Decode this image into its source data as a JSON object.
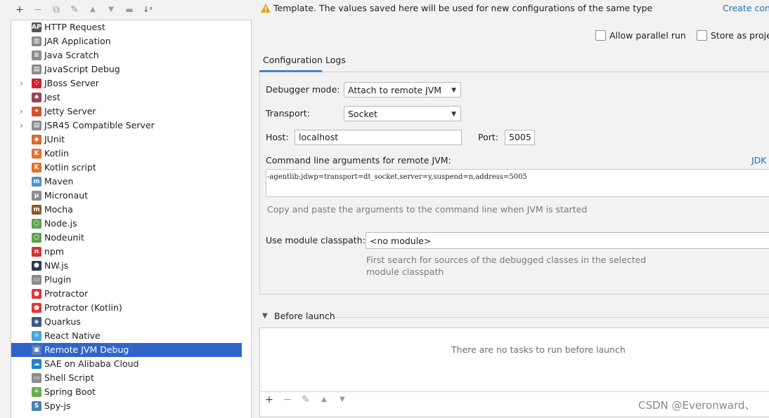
{
  "toolbar": {
    "icons": [
      "plus-icon",
      "minus-icon",
      "copy-icon",
      "wrench-icon",
      "arrow-up-icon",
      "arrow-down-icon",
      "folder-add-icon",
      "sort-az-icon"
    ]
  },
  "tree": {
    "items": [
      {
        "label": "HTTP Request",
        "icon": "api-icon",
        "color": "#555555",
        "glyph": "API",
        "expandable": false
      },
      {
        "label": "JAR Application",
        "icon": "jar-icon",
        "color": "#8c8c8c",
        "glyph": "▥",
        "expandable": false
      },
      {
        "label": "Java Scratch",
        "icon": "java-scratch-icon",
        "color": "#8c8c8c",
        "glyph": "≡",
        "expandable": false
      },
      {
        "label": "JavaScript Debug",
        "icon": "js-debug-icon",
        "color": "#8c8c8c",
        "glyph": "▤",
        "expandable": false
      },
      {
        "label": "JBoss Server",
        "icon": "jboss-icon",
        "color": "#d0202a",
        "glyph": "⁘",
        "expandable": true
      },
      {
        "label": "Jest",
        "icon": "jest-icon",
        "color": "#99425b",
        "glyph": "♠",
        "expandable": false
      },
      {
        "label": "Jetty Server",
        "icon": "jetty-icon",
        "color": "#d94f2b",
        "glyph": "✦",
        "expandable": true
      },
      {
        "label": "JSR45 Compatible Server",
        "icon": "jsr45-icon",
        "color": "#8c8c8c",
        "glyph": "▤",
        "expandable": true
      },
      {
        "label": "JUnit",
        "icon": "junit-icon",
        "color": "#d96a2a",
        "glyph": "◆",
        "expandable": false
      },
      {
        "label": "Kotlin",
        "icon": "kotlin-icon",
        "color": "#e0712f",
        "glyph": "K",
        "expandable": false
      },
      {
        "label": "Kotlin script",
        "icon": "kotlin-script-icon",
        "color": "#e0712f",
        "glyph": "K",
        "expandable": false
      },
      {
        "label": "Maven",
        "icon": "maven-icon",
        "color": "#4f8fd1",
        "glyph": "m",
        "expandable": false
      },
      {
        "label": "Micronaut",
        "icon": "micronaut-icon",
        "color": "#8c8c8c",
        "glyph": "μ",
        "expandable": false
      },
      {
        "label": "Mocha",
        "icon": "mocha-icon",
        "color": "#8b5a2b",
        "glyph": "m",
        "expandable": false
      },
      {
        "label": "Node.js",
        "icon": "nodejs-icon",
        "color": "#5fa04e",
        "glyph": "⬡",
        "expandable": false
      },
      {
        "label": "Nodeunit",
        "icon": "nodeunit-icon",
        "color": "#5fa04e",
        "glyph": "⬡",
        "expandable": false
      },
      {
        "label": "npm",
        "icon": "npm-icon",
        "color": "#cb3837",
        "glyph": "n",
        "expandable": false
      },
      {
        "label": "NW.js",
        "icon": "nwjs-icon",
        "color": "#2b3a4a",
        "glyph": "⬢",
        "expandable": false
      },
      {
        "label": "Plugin",
        "icon": "plugin-icon",
        "color": "#8c8c8c",
        "glyph": "▭",
        "expandable": false
      },
      {
        "label": "Protractor",
        "icon": "protractor-icon",
        "color": "#e23237",
        "glyph": "●",
        "expandable": false
      },
      {
        "label": "Protractor (Kotlin)",
        "icon": "protractor-kotlin-icon",
        "color": "#e23237",
        "glyph": "●",
        "expandable": false
      },
      {
        "label": "Quarkus",
        "icon": "quarkus-icon",
        "color": "#3b5a80",
        "glyph": "◈",
        "expandable": false
      },
      {
        "label": "React Native",
        "icon": "react-icon",
        "color": "#4aa3d9",
        "glyph": "⚛",
        "expandable": false
      },
      {
        "label": "Remote JVM Debug",
        "icon": "remote-debug-icon",
        "color": "#5a7fb5",
        "glyph": "▣",
        "expandable": false,
        "selected": true
      },
      {
        "label": "SAE on Alibaba Cloud",
        "icon": "cloud-icon",
        "color": "#1f7fd1",
        "glyph": "☁",
        "expandable": false
      },
      {
        "label": "Shell Script",
        "icon": "shell-icon",
        "color": "#8c8c8c",
        "glyph": "▭",
        "expandable": false
      },
      {
        "label": "Spring Boot",
        "icon": "spring-boot-icon",
        "color": "#6ab04c",
        "glyph": "⚘",
        "expandable": false
      },
      {
        "label": "Spy-js",
        "icon": "spyjs-icon",
        "color": "#4a7fb5",
        "glyph": "S",
        "expandable": false
      }
    ]
  },
  "header": {
    "warning": "Template. The values saved here will be used for new configurations of the same type",
    "create_link": "Create conf"
  },
  "options": {
    "parallel_label": "Allow parallel run",
    "store_label": "Store as proje"
  },
  "tabs": {
    "configuration": "Configuration",
    "logs": "Logs"
  },
  "form": {
    "debugger_mode_label": "Debugger mode:",
    "debugger_mode_value": "Attach to remote JVM",
    "transport_label": "Transport:",
    "transport_value": "Socket",
    "host_label": "Host:",
    "host_value": "localhost",
    "port_label": "Port:",
    "port_value": "5005",
    "cmd_label": "Command line arguments for remote JVM:",
    "jdk_link": "JDK",
    "cmd_value": "-agentlib:jdwp=transport=dt_socket,server=y,suspend=n,address=5005",
    "cmd_hint": "Copy and paste the arguments to the command line when JVM is started",
    "module_label": "Use module classpath:",
    "module_value": "<no module>",
    "module_hint_line1": "First search for sources of the debugged classes in the selected",
    "module_hint_line2": "module classpath"
  },
  "before_launch": {
    "label": "Before launch",
    "empty": "There are no tasks to run before launch"
  },
  "watermark": "CSDN @Everonward、"
}
